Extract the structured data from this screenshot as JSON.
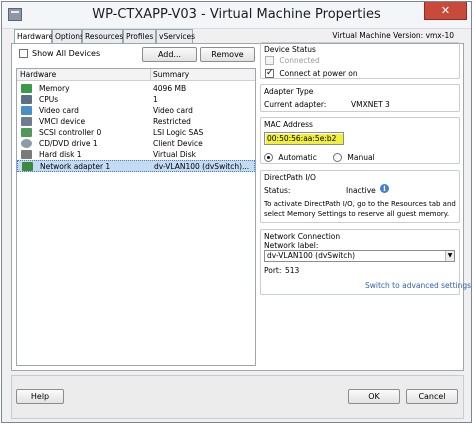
{
  "window": {
    "title": "WP-CTXAPP-V03 - Virtual Machine Properties",
    "close_glyph": "✕"
  },
  "tabs": [
    {
      "label": "Hardware",
      "active": true
    },
    {
      "label": "Options",
      "active": false
    },
    {
      "label": "Resources",
      "active": false
    },
    {
      "label": "Profiles",
      "active": false
    },
    {
      "label": "vServices",
      "active": false
    }
  ],
  "vm_version": "Virtual Machine Version: vmx-10",
  "left": {
    "show_all_devices": {
      "label": "Show All Devices",
      "checked": false
    },
    "add_button": "Add...",
    "remove_button": "Remove",
    "table": {
      "columns": [
        "Hardware",
        "Summary"
      ],
      "rows": [
        {
          "name": "Memory",
          "summary": "4096 MB",
          "icon": "memory-icon",
          "color": "#3a9a4a"
        },
        {
          "name": "CPUs",
          "summary": "1",
          "icon": "cpu-icon",
          "color": "#5a6f8a"
        },
        {
          "name": "Video card",
          "summary": "Video card",
          "icon": "video-card-icon",
          "color": "#4a8fc7"
        },
        {
          "name": "VMCI device",
          "summary": "Restricted",
          "icon": "vmci-device-icon",
          "color": "#6e7e8e"
        },
        {
          "name": "SCSI controller 0",
          "summary": "LSI Logic SAS",
          "icon": "scsi-controller-icon",
          "color": "#4d9a5a"
        },
        {
          "name": "CD/DVD drive 1",
          "summary": "Client Device",
          "icon": "cd-dvd-icon",
          "color": "#8a9aa8"
        },
        {
          "name": "Hard disk 1",
          "summary": "Virtual Disk",
          "icon": "hard-disk-icon",
          "color": "#7a7a7a"
        },
        {
          "name": "Network adapter 1",
          "summary": "dv-VLAN100 (dvSwitch)...",
          "icon": "network-adapter-icon",
          "color": "#3c8a3c",
          "selected": true
        }
      ]
    }
  },
  "right": {
    "device_status": {
      "title": "Device Status",
      "connected": {
        "label": "Connected",
        "checked": false,
        "disabled": true
      },
      "connect_at_power_on": {
        "label": "Connect at power on",
        "checked": true
      }
    },
    "adapter_type": {
      "title": "Adapter Type",
      "current_label": "Current adapter:",
      "current_value": "VMXNET 3"
    },
    "mac_address": {
      "title": "MAC Address",
      "value": "00:50:56:aa:5e:b2",
      "highlight_color": "#f2ee3d",
      "automatic": {
        "label": "Automatic",
        "selected": true
      },
      "manual": {
        "label": "Manual",
        "selected": false
      }
    },
    "directpath": {
      "title": "DirectPath I/O",
      "status_label": "Status:",
      "status_value": "Inactive",
      "info_glyph": "i",
      "description_line1": "To activate DirectPath I/O, go to the Resources tab and",
      "description_line2": "select Memory Settings to reserve all guest memory."
    },
    "network_connection": {
      "title": "Network Connection",
      "network_label": "Network label:",
      "network_value": "dv-VLAN100 (dvSwitch)",
      "port_label": "Port:",
      "port_value": "513",
      "advanced_link": "Switch to advanced settings"
    }
  },
  "footer": {
    "help": "Help",
    "ok": "OK",
    "cancel": "Cancel"
  }
}
